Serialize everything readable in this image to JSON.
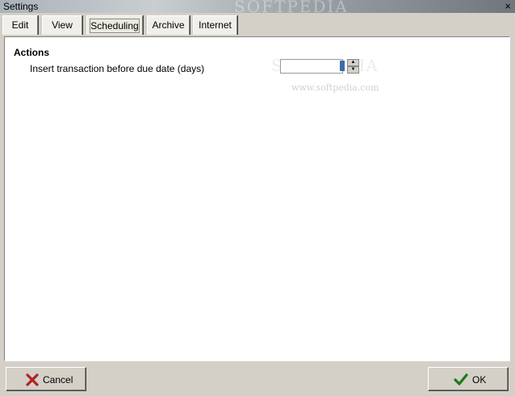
{
  "window": {
    "title": "Settings",
    "close_glyph": "×",
    "watermark": "SOFTPEDIA"
  },
  "tabs": [
    {
      "label": "Edit"
    },
    {
      "label": "View"
    },
    {
      "label": "Scheduling",
      "active": true
    },
    {
      "label": "Archive"
    },
    {
      "label": "Internet"
    }
  ],
  "panel": {
    "heading": "Actions",
    "field_label": "Insert transaction before due date (days)",
    "field_value": "",
    "watermark_url": "www.softpedia.com",
    "watermark_logo": "SOFTPEDIA"
  },
  "footer": {
    "cancel_label": "Cancel",
    "cancel_icon": "x-icon",
    "ok_label": "OK",
    "ok_icon": "checkmark-icon",
    "cancel_icon_color": "#b22222",
    "ok_icon_color": "#1a7a1a"
  }
}
